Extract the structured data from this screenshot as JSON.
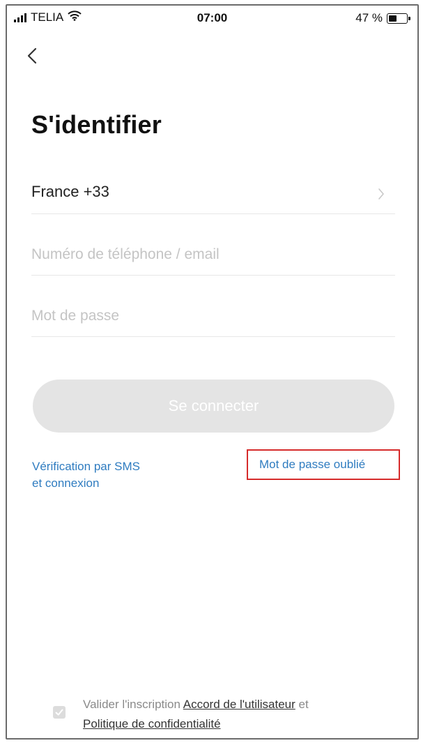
{
  "status_bar": {
    "carrier": "TELIA",
    "time": "07:00",
    "battery": "47 %"
  },
  "page": {
    "title": "S'identifier"
  },
  "form": {
    "country": "France +33",
    "phone_placeholder": "Numéro de téléphone / email",
    "password_placeholder": "Mot de passe",
    "login_label": "Se connecter"
  },
  "links": {
    "sms_line1": "Vérification par SMS",
    "sms_line2": "et connexion",
    "forgot_password": "Mot de passe oublié"
  },
  "agreement": {
    "prefix": "Valider l'inscription",
    "user_agreement": "Accord de l'utilisateur",
    "and": "et",
    "privacy_policy": "Politique de confidentialité"
  },
  "colors": {
    "link": "#2f7cc0",
    "highlight": "#d62b2b",
    "button_disabled": "#e4e4e4"
  }
}
